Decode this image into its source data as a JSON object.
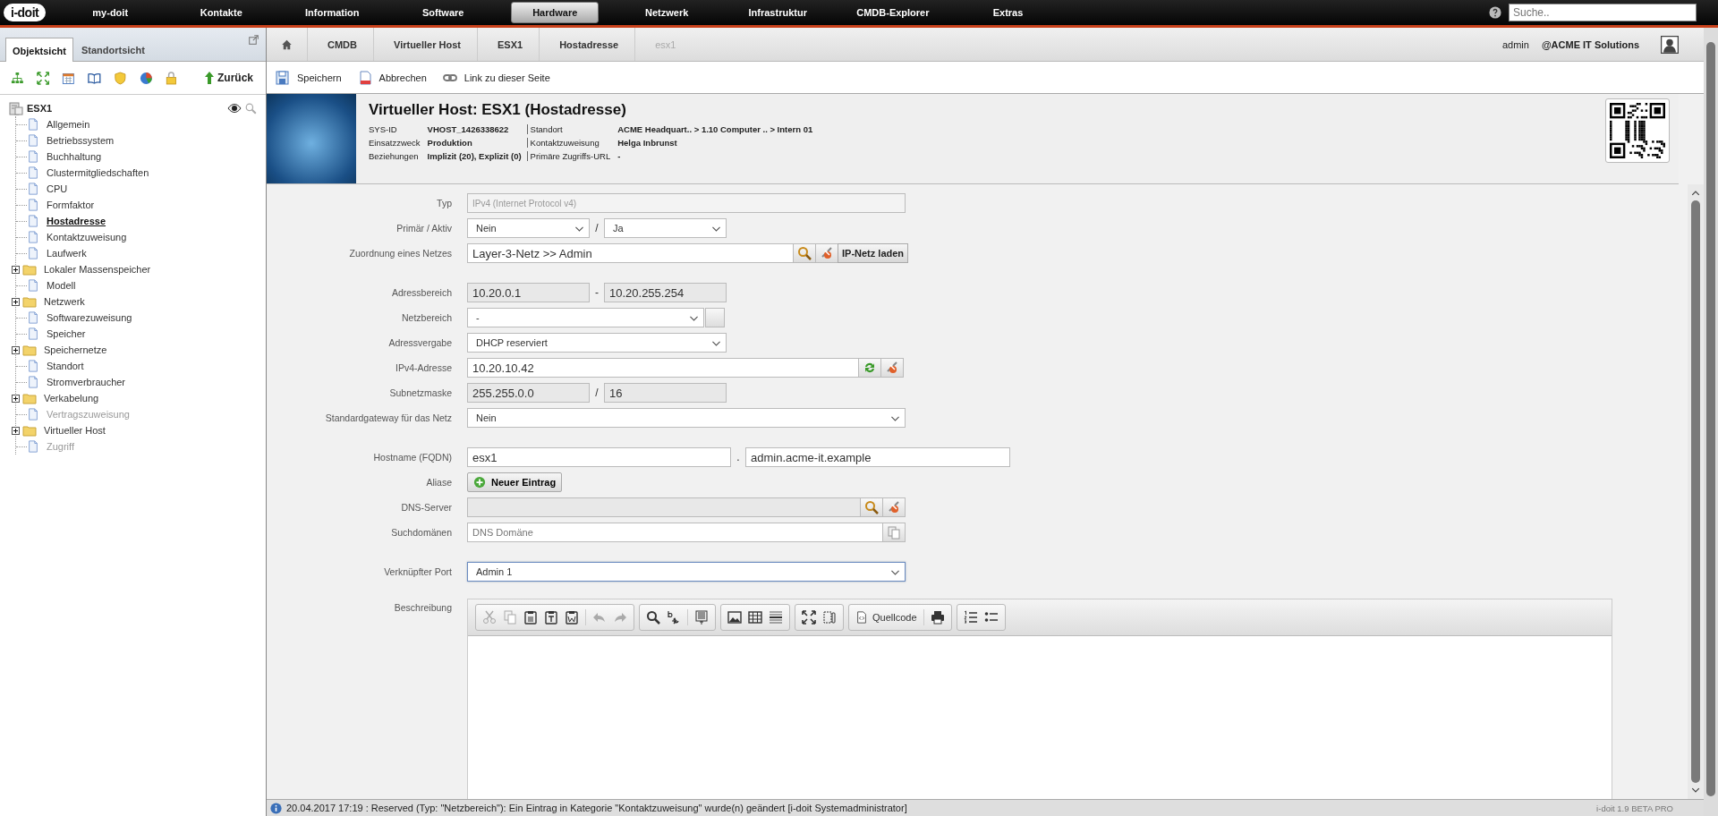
{
  "top_nav": {
    "logo": "i-doit",
    "items": [
      {
        "label": "my-doit",
        "selected": false
      },
      {
        "label": "Kontakte",
        "selected": false
      },
      {
        "label": "Information",
        "selected": false
      },
      {
        "label": "Software",
        "selected": false
      },
      {
        "label": "Hardware",
        "selected": true
      },
      {
        "label": "Netzwerk",
        "selected": false
      },
      {
        "label": "Infrastruktur",
        "selected": false
      },
      {
        "label": "CMDB-Explorer",
        "selected": false
      },
      {
        "label": "Extras",
        "selected": false
      }
    ],
    "search": {
      "placeholder": "Suche.."
    }
  },
  "sidebar": {
    "tabs": [
      {
        "label": "Objektsicht",
        "selected": true
      },
      {
        "label": "Standortsicht",
        "selected": false
      }
    ],
    "back_button": "Zurück",
    "tree": {
      "label": "ESX1",
      "children": [
        {
          "label": "Allgemein",
          "kind": "category",
          "selected": false,
          "disabled": false
        },
        {
          "label": "Betriebssystem",
          "kind": "category",
          "selected": false,
          "disabled": false
        },
        {
          "label": "Buchhaltung",
          "kind": "category",
          "selected": false,
          "disabled": false
        },
        {
          "label": "Clustermitgliedschaften",
          "kind": "category",
          "selected": false,
          "disabled": false
        },
        {
          "label": "CPU",
          "kind": "category",
          "selected": false,
          "disabled": false
        },
        {
          "label": "Formfaktor",
          "kind": "category",
          "selected": false,
          "disabled": false
        },
        {
          "label": "Hostadresse",
          "kind": "category",
          "selected": true,
          "disabled": false
        },
        {
          "label": "Kontaktzuweisung",
          "kind": "category",
          "selected": false,
          "disabled": false
        },
        {
          "label": "Laufwerk",
          "kind": "category",
          "selected": false,
          "disabled": false
        },
        {
          "label": "Lokaler Massenspeicher",
          "kind": "folder",
          "expanded": false
        },
        {
          "label": "Modell",
          "kind": "category",
          "selected": false,
          "disabled": false
        },
        {
          "label": "Netzwerk",
          "kind": "folder",
          "expanded": false
        },
        {
          "label": "Softwarezuweisung",
          "kind": "category",
          "selected": false,
          "disabled": false
        },
        {
          "label": "Speicher",
          "kind": "category",
          "selected": false,
          "disabled": false
        },
        {
          "label": "Speichernetze",
          "kind": "folder",
          "expanded": false
        },
        {
          "label": "Standort",
          "kind": "category",
          "selected": false,
          "disabled": false
        },
        {
          "label": "Stromverbraucher",
          "kind": "category",
          "selected": false,
          "disabled": false
        },
        {
          "label": "Verkabelung",
          "kind": "folder",
          "expanded": false
        },
        {
          "label": "Vertragszuweisung",
          "kind": "category",
          "selected": false,
          "disabled": true
        },
        {
          "label": "Virtueller Host",
          "kind": "folder",
          "expanded": false
        },
        {
          "label": "Zugriff",
          "kind": "category",
          "selected": false,
          "disabled": true
        }
      ]
    }
  },
  "breadcrumb": [
    {
      "label": "CMDB",
      "disabled": false
    },
    {
      "label": "Virtueller Host",
      "disabled": false
    },
    {
      "label": "ESX1",
      "disabled": false
    },
    {
      "label": "Hostadresse",
      "disabled": false
    },
    {
      "label": "esx1",
      "disabled": true
    }
  ],
  "user": {
    "name": "admin",
    "tenant": "@ACME IT Solutions"
  },
  "actions": [
    {
      "label": "Speichern",
      "kind": "save"
    },
    {
      "label": "Abbrechen",
      "kind": "cancel"
    },
    {
      "label": "Link zu dieser Seite",
      "kind": "link"
    }
  ],
  "header": {
    "title": "Virtueller Host: ESX1 (Hostadresse)",
    "info": [
      {
        "label": "SYS-ID",
        "value": "VHOST_1426338622"
      },
      {
        "label": "Einsatzzweck",
        "value": "Produktion"
      },
      {
        "label": "Beziehungen",
        "value": "Implizit (20), Explizit (0)"
      },
      {
        "label": "Standort",
        "value": "ACME Headquart.. > 1.10 Computer .. > Intern 01"
      },
      {
        "label": "Kontaktzuweisung",
        "value": "Helga Inbrunst"
      },
      {
        "label": "Primäre Zugriffs-URL",
        "value": "-"
      }
    ]
  },
  "form": {
    "groups": [
      [
        {
          "label": "Typ",
          "kind": "text",
          "disabled": true,
          "value": "IPv4 (Internet Protocol v4)"
        },
        {
          "label": "Primär / Aktiv",
          "kind": "select_pair",
          "values": [
            "Nein",
            "Ja"
          ],
          "separator": "/"
        },
        {
          "label": "Zuordnung eines Netzes",
          "kind": "browser",
          "value": "Layer-3-Netz >> Admin",
          "button": "IP-Netz laden"
        }
      ],
      [
        {
          "label": "Adressbereich",
          "kind": "readonly_pair",
          "values": [
            "10.20.0.1",
            "10.20.255.254"
          ],
          "separator": "-"
        },
        {
          "label": "Netzbereich",
          "kind": "select_button",
          "value": "-"
        },
        {
          "label": "Adressvergabe",
          "kind": "select_short",
          "value": "DHCP reserviert"
        },
        {
          "label": "IPv4-Adresse",
          "kind": "ip",
          "value": "10.20.10.42"
        },
        {
          "label": "Subnetzmaske",
          "kind": "readonly_pair",
          "values": [
            "255.255.0.0",
            "16"
          ],
          "separator": "/"
        },
        {
          "label": "Standardgateway für das Netz",
          "kind": "select",
          "value": "Nein",
          "focused": false
        }
      ],
      [
        {
          "label": "Hostname (FQDN)",
          "kind": "text_pair",
          "values": [
            "esx1",
            "admin.acme-it.example"
          ],
          "separator": "."
        },
        {
          "label": "Aliase",
          "kind": "add",
          "button": "Neuer Eintrag"
        },
        {
          "label": "DNS-Server",
          "kind": "browser"
        },
        {
          "label": "Suchdomänen",
          "kind": "tags",
          "placeholder": "DNS Domäne"
        }
      ],
      [
        {
          "label": "Verknüpfter Port",
          "kind": "select",
          "value": "Admin 1",
          "focused": true
        }
      ],
      [
        {
          "label": "Beschreibung",
          "kind": "editor",
          "source_button": "Quellcode"
        }
      ]
    ]
  },
  "status_bar": {
    "message": "20.04.2017 17:19 : Reserved (Typ: \"Netzbereich\"): Ein Eintrag in Kategorie \"Kontaktzuweisung\" wurde(n) geändert [i-doit Systemadministrator]",
    "version": "i-doit 1.9 BETA PRO"
  }
}
